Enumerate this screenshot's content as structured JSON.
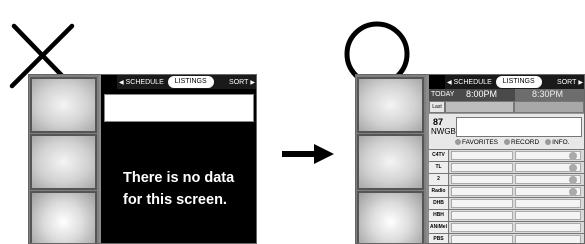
{
  "left": {
    "menu": {
      "schedule": "SCHEDULE",
      "listings": "LISTINGS",
      "sort": "SORT"
    },
    "message_line1": "There is no data",
    "message_line2": "for this screen."
  },
  "right": {
    "menu": {
      "schedule": "SCHEDULE",
      "listings": "LISTINGS",
      "sort": "SORT"
    },
    "timebar": {
      "today": "TODAY",
      "time1": "8:00PM",
      "time2": "8:30PM"
    },
    "last_label": "Last",
    "channel": {
      "number": "87",
      "name": "NWGB"
    },
    "actions": {
      "favorites": "FAVORITES",
      "record": "RECORD",
      "info": "INFO."
    },
    "rows": [
      {
        "logo": "C4TV"
      },
      {
        "logo": "TL"
      },
      {
        "logo": "2"
      },
      {
        "logo": "Radio"
      },
      {
        "logo": "DHB"
      },
      {
        "logo": "HBH"
      },
      {
        "logo": "ANiMel"
      },
      {
        "logo": "PBS"
      }
    ]
  },
  "colors": {
    "marks": "#000000",
    "panel_bg": "#cfcfcf",
    "screen_bg": "#8c8c8c"
  }
}
